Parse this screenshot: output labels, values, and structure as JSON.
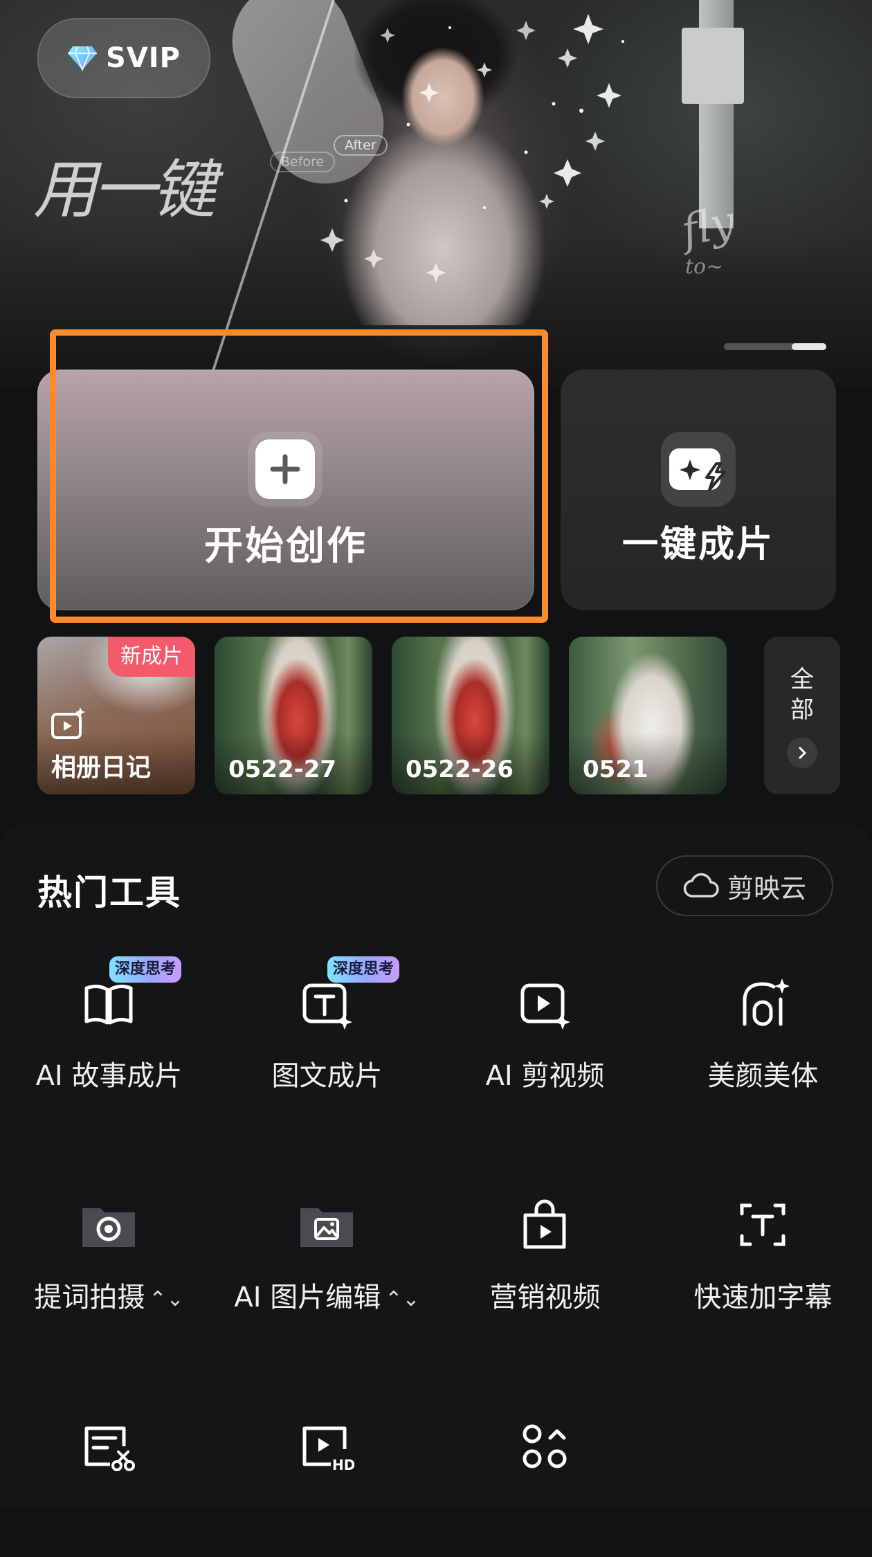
{
  "hero": {
    "svip_label": "SVIP",
    "headline_text": "用一键",
    "after_label": "After",
    "before_label": "Before",
    "fly_text": "fly",
    "fly_sub_text": "to~",
    "carousel": {
      "total_slides": 3,
      "active_slide": 3
    }
  },
  "actions": {
    "start_creating_label": "开始创作",
    "one_click_label": "一键成片",
    "highlight_color": "#ff8a2a"
  },
  "drafts": {
    "items": [
      {
        "label": "相册日记",
        "badge": "新成片"
      },
      {
        "label": "0522-27"
      },
      {
        "label": "0522-26"
      },
      {
        "label": "0521"
      }
    ],
    "view_all_label": "全\n部"
  },
  "tools": {
    "section_title": "热门工具",
    "cloud_button_label": "剪映云",
    "items": [
      {
        "label": "AI 故事成片",
        "badge": "深度思考",
        "icon": "book-icon"
      },
      {
        "label": "图文成片",
        "badge": "深度思考",
        "icon": "text-sparkle-icon"
      },
      {
        "label": "AI 剪视频",
        "icon": "video-sparkle-icon"
      },
      {
        "label": "美颜美体",
        "icon": "beauty-icon"
      },
      {
        "label": "提词拍摄",
        "icon": "teleprompter-camera-icon",
        "has_sort": true
      },
      {
        "label": "AI 图片编辑",
        "icon": "image-edit-icon",
        "has_sort": true
      },
      {
        "label": "营销视频",
        "icon": "shopping-bag-video-icon"
      },
      {
        "label": "快速加字幕",
        "icon": "subtitle-icon"
      },
      {
        "icon": "script-cut-icon"
      },
      {
        "icon": "hd-video-icon"
      },
      {
        "icon": "more-tools-icon"
      }
    ]
  }
}
